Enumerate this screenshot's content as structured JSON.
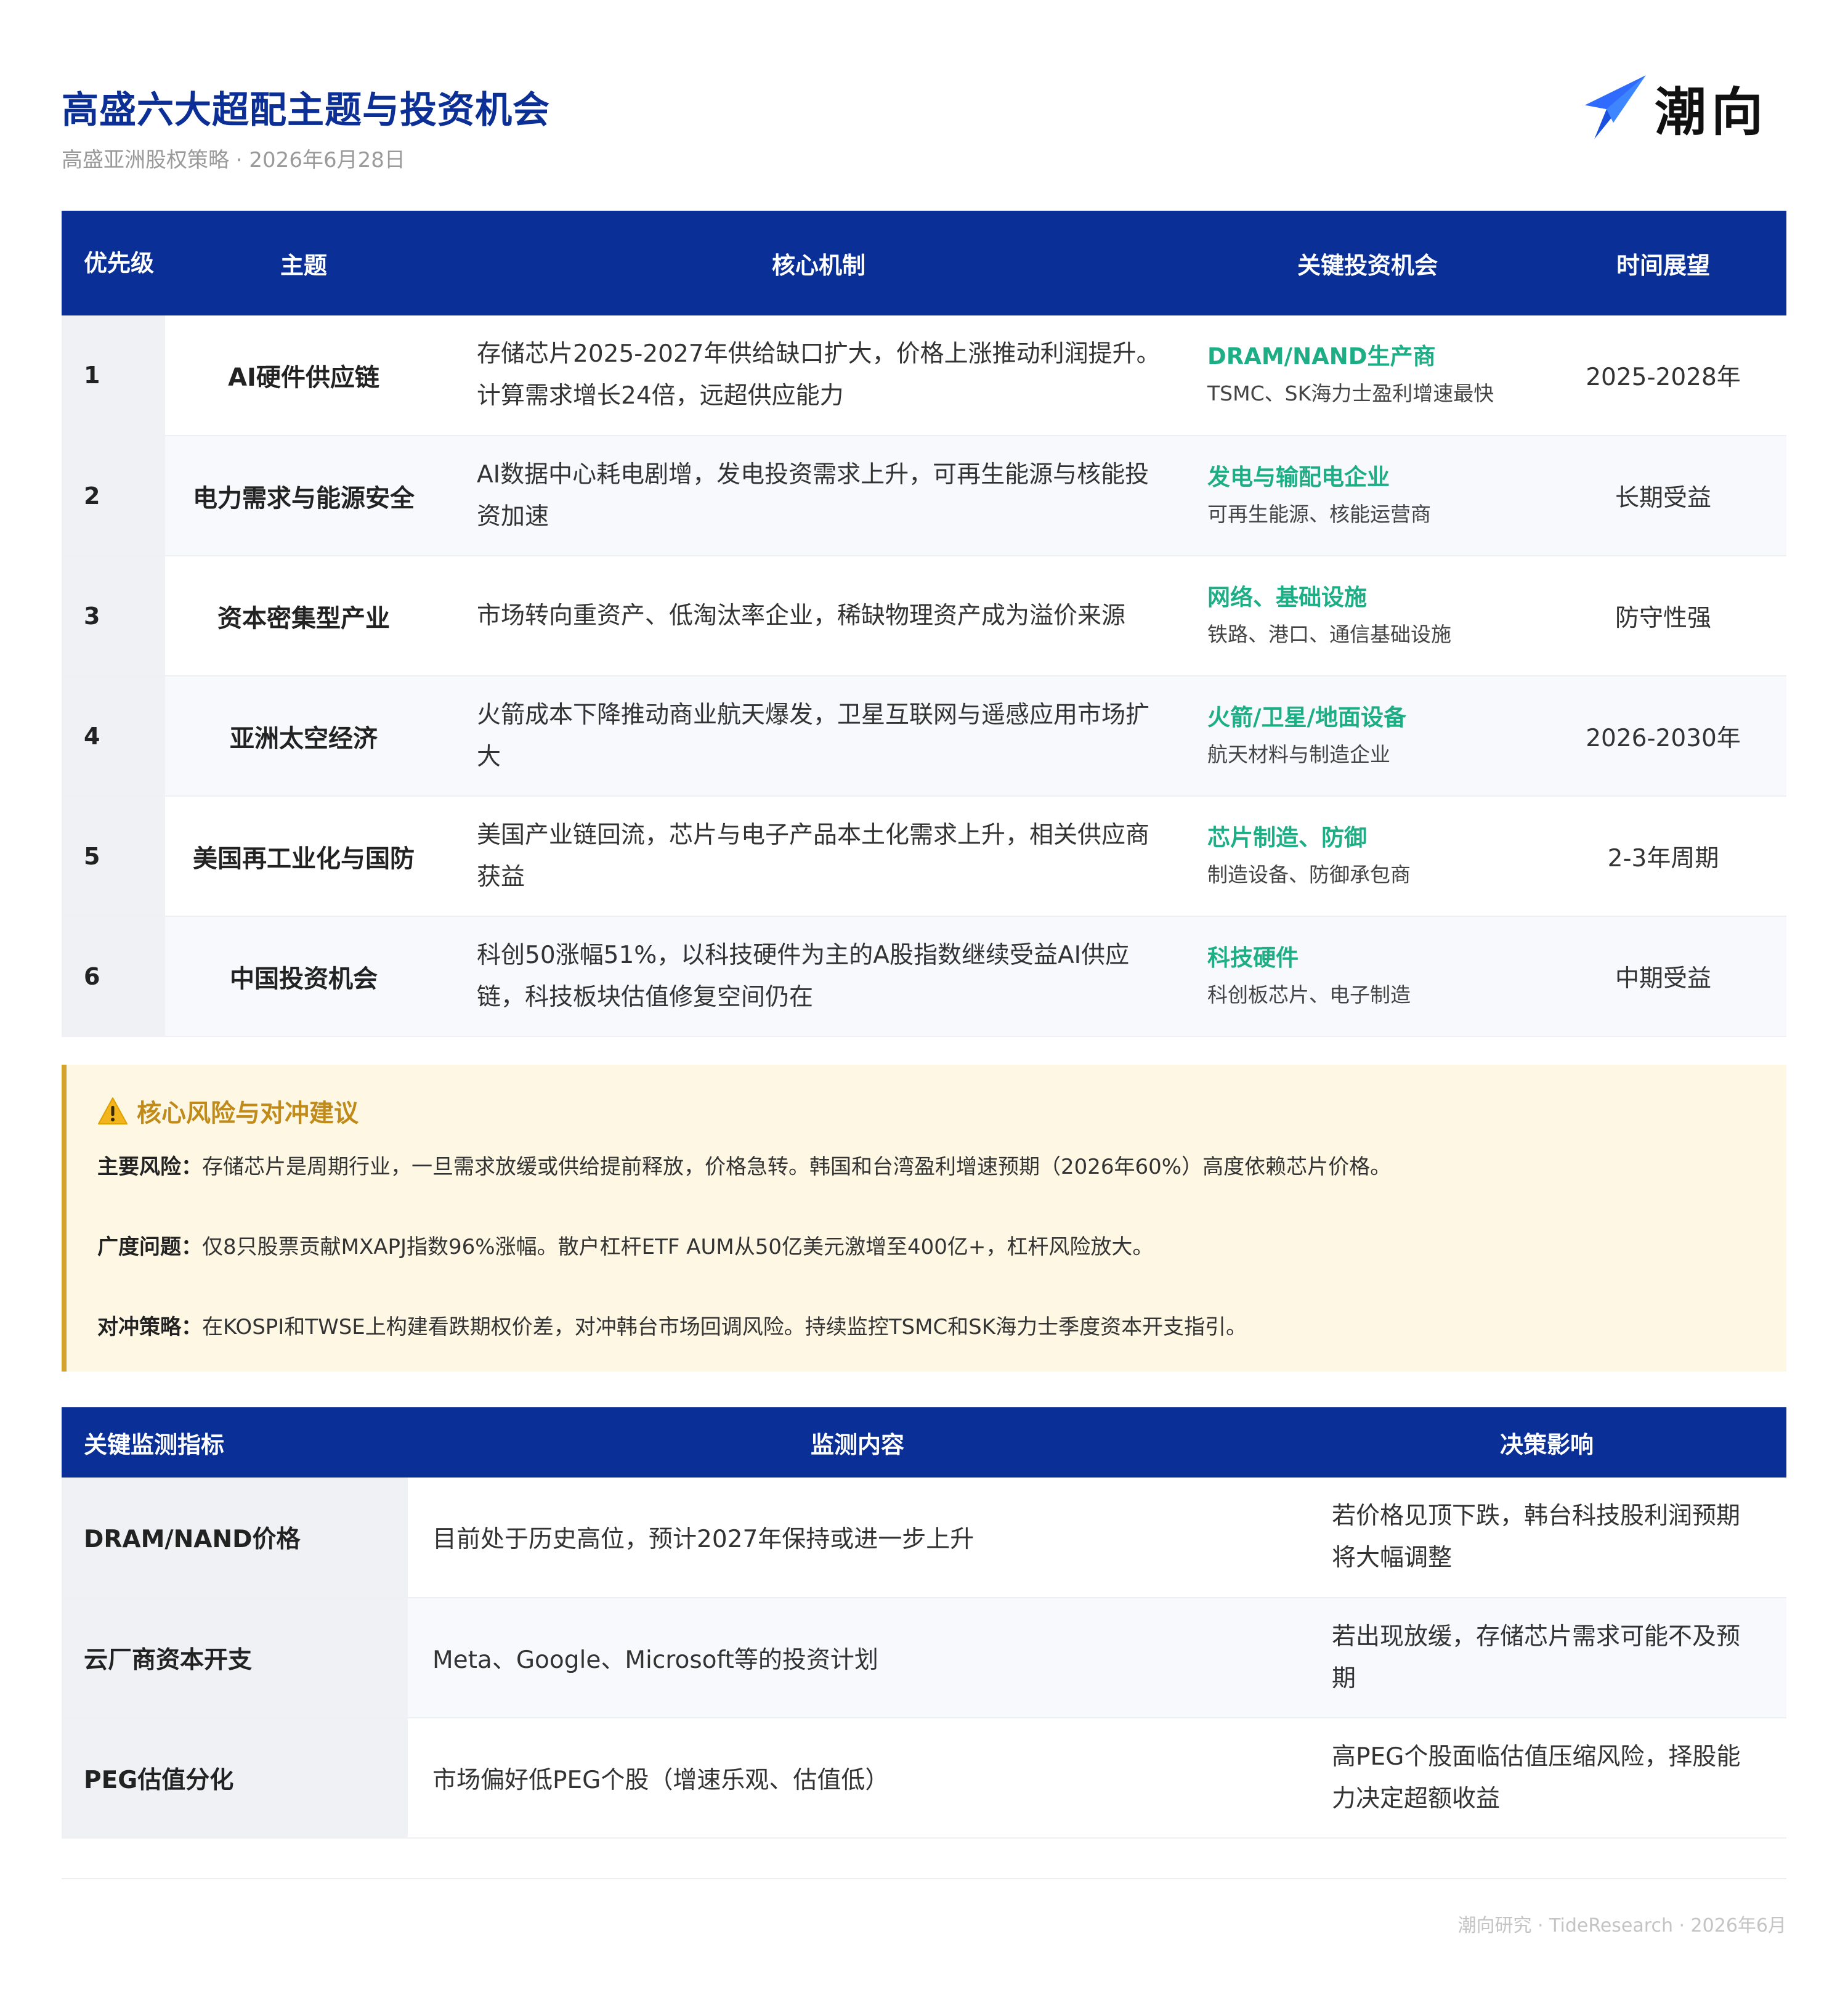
{
  "header": {
    "title": "高盛六大超配主题与投资机会",
    "subtitle": "高盛亚洲股权策略 · 2026年6月28日",
    "brand": "潮向",
    "brand_color": "#1e5bff"
  },
  "themes": {
    "columns": [
      "优先级",
      "主题",
      "核心机制",
      "关键投资机会",
      "时间展望"
    ],
    "rows": [
      {
        "priority": "1",
        "theme": "AI硬件供应链",
        "mechanism": "存储芯片2025-2027年供给缺口扩大，价格上涨推动利润提升。计算需求增长24倍，远超供应能力",
        "opp_head": "DRAM/NAND生产商",
        "opp_sub": "TSMC、SK海力士盈利增速最快",
        "horizon": "2025-2028年"
      },
      {
        "priority": "2",
        "theme": "电力需求与能源安全",
        "mechanism": "AI数据中心耗电剧增，发电投资需求上升，可再生能源与核能投资加速",
        "opp_head": "发电与输配电企业",
        "opp_sub": "可再生能源、核能运营商",
        "horizon": "长期受益"
      },
      {
        "priority": "3",
        "theme": "资本密集型产业",
        "mechanism": "市场转向重资产、低淘汰率企业，稀缺物理资产成为溢价来源",
        "opp_head": "网络、基础设施",
        "opp_sub": "铁路、港口、通信基础设施",
        "horizon": "防守性强"
      },
      {
        "priority": "4",
        "theme": "亚洲太空经济",
        "mechanism": "火箭成本下降推动商业航天爆发，卫星互联网与遥感应用市场扩大",
        "opp_head": "火箭/卫星/地面设备",
        "opp_sub": "航天材料与制造企业",
        "horizon": "2026-2030年"
      },
      {
        "priority": "5",
        "theme": "美国再工业化与国防",
        "mechanism": "美国产业链回流，芯片与电子产品本土化需求上升，相关供应商获益",
        "opp_head": "芯片制造、防御",
        "opp_sub": "制造设备、防御承包商",
        "horizon": "2-3年周期"
      },
      {
        "priority": "6",
        "theme": "中国投资机会",
        "mechanism": "科创50涨幅51%，以科技硬件为主的A股指数继续受益AI供应链，科技板块估值修复空间仍在",
        "opp_head": "科技硬件",
        "opp_sub": "科创板芯片、电子制造",
        "horizon": "中期受益"
      }
    ]
  },
  "risk": {
    "title": "核心风险与对冲建议",
    "items": [
      {
        "label": "主要风险：",
        "text": "存储芯片是周期行业，一旦需求放缓或供给提前释放，价格急转。韩国和台湾盈利增速预期（2026年60%）高度依赖芯片价格。"
      },
      {
        "label": "广度问题：",
        "text": "仅8只股票贡献MXAPJ指数96%涨幅。散户杠杆ETF AUM从50亿美元激增至400亿+，杠杆风险放大。"
      },
      {
        "label": "对冲策略：",
        "text": "在KOSPI和TWSE上构建看跌期权价差，对冲韩台市场回调风险。持续监控TSMC和SK海力士季度资本开支指引。"
      }
    ]
  },
  "monitor": {
    "columns": [
      "关键监测指标",
      "监测内容",
      "决策影响"
    ],
    "rows": [
      {
        "indicator": "DRAM/NAND价格",
        "content": "目前处于历史高位，预计2027年保持或进一步上升",
        "impact": "若价格见顶下跌，韩台科技股利润预期将大幅调整"
      },
      {
        "indicator": "云厂商资本开支",
        "content": "Meta、Google、Microsoft等的投资计划",
        "impact": "若出现放缓，存储芯片需求可能不及预期"
      },
      {
        "indicator": "PEG估值分化",
        "content": "市场偏好低PEG个股（增速乐观、估值低）",
        "impact": "高PEG个股面临估值压缩风险，择股能力决定超额收益"
      }
    ]
  },
  "footer": "潮向研究 · TideResearch · 2026年6月"
}
